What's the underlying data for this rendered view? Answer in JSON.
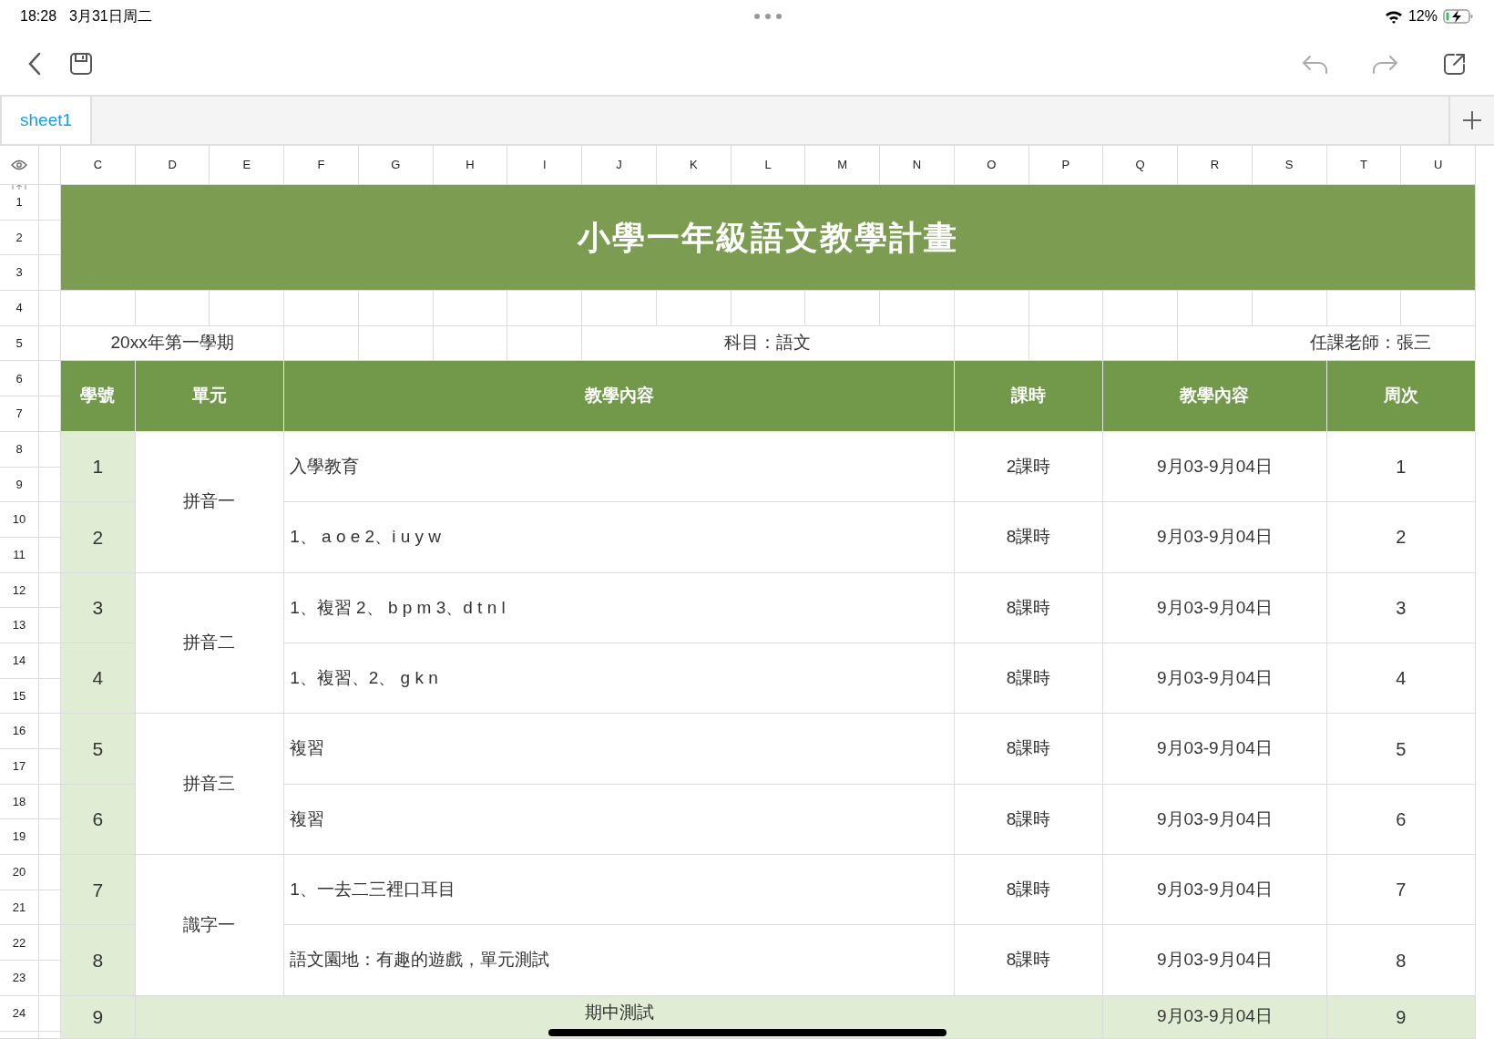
{
  "status_bar": {
    "time": "18:28",
    "date": "3月31日周二",
    "battery": "12%"
  },
  "tabs": [
    {
      "label": "sheet1",
      "selected": true
    }
  ],
  "column_headers": [
    "C",
    "D",
    "E",
    "F",
    "G",
    "H",
    "I",
    "J",
    "K",
    "L",
    "M",
    "N",
    "O",
    "P",
    "Q",
    "R",
    "S",
    "T",
    "U"
  ],
  "row_numbers": [
    "1",
    "2",
    "3",
    "4",
    "5",
    "6",
    "7",
    "8",
    "9",
    "10",
    "11",
    "12",
    "13",
    "14",
    "15",
    "16",
    "17",
    "18",
    "19",
    "20",
    "21",
    "22",
    "23",
    "24"
  ],
  "title": "小學一年級語文教學計畫",
  "info": {
    "term": "20xx年第一學期",
    "subject": "科目：語文",
    "teacher": "任課老師：張三"
  },
  "table": {
    "columns": [
      "學號",
      "單元",
      "教學內容",
      "課時",
      "教學內容",
      "周次"
    ],
    "units": [
      {
        "name": "拼音一",
        "lessons": [
          {
            "no": "1",
            "content": "入學教育",
            "hours": "2課時",
            "dates": "9月03-9月04日",
            "week": "1"
          },
          {
            "no": "2",
            "content": "1、 a o e 2、i u y w",
            "hours": "8課時",
            "dates": "9月03-9月04日",
            "week": "2"
          }
        ]
      },
      {
        "name": "拼音二",
        "lessons": [
          {
            "no": "3",
            "content": "1、複習 2、 b p m 3、d t n l",
            "hours": "8課時",
            "dates": "9月03-9月04日",
            "week": "3"
          },
          {
            "no": "4",
            "content": "1、複習、2、 g k n",
            "hours": "8課時",
            "dates": "9月03-9月04日",
            "week": "4"
          }
        ]
      },
      {
        "name": "拼音三",
        "lessons": [
          {
            "no": "5",
            "content": "複習",
            "hours": "8課時",
            "dates": "9月03-9月04日",
            "week": "5"
          },
          {
            "no": "6",
            "content": "複習",
            "hours": "8課時",
            "dates": "9月03-9月04日",
            "week": "6"
          }
        ]
      },
      {
        "name": "識字一",
        "lessons": [
          {
            "no": "7",
            "content": "1、一去二三裡口耳目",
            "hours": "8課時",
            "dates": "9月03-9月04日",
            "week": "7"
          },
          {
            "no": "8",
            "content": "語文園地：有趣的遊戲，單元測試",
            "hours": "8課時",
            "dates": "9月03-9月04日",
            "week": "8"
          }
        ]
      }
    ],
    "final_row": {
      "no": "9",
      "content": "期中測試",
      "dates": "9月03-9月04日",
      "week": "9"
    }
  }
}
